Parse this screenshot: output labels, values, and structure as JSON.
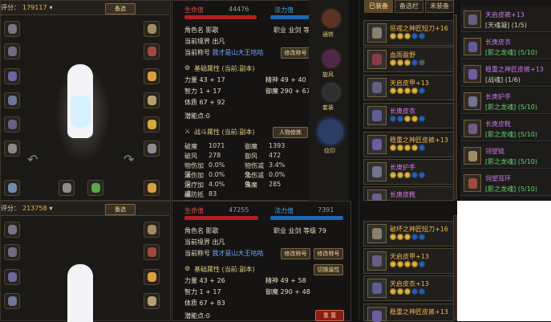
{
  "top_rating": {
    "label": "评分：",
    "value": "179117",
    "btn": "备选"
  },
  "bottom_rating": {
    "label": "评分：",
    "value": "213758",
    "btn": "备选"
  },
  "top_panel": {
    "hp_label": "生命值",
    "hp_value": "44476",
    "mp_label": "法力值",
    "role_label": "角色名",
    "role_value": "影歌",
    "job_label": "职业",
    "job_value": "业剑",
    "level_label": "等级",
    "level_value": "",
    "realm_label": "当前境界",
    "realm_value": "出凡",
    "title_label": "当前称号",
    "title_value": "我才是山大王咕咕",
    "modify_btn": "修改称号",
    "basic_title": "基础属性 (当前:副本)",
    "power": "力量 43 + 17",
    "spirit": "精神 49 + 40",
    "int": "智力 1 + 17",
    "def": "御魔 290 + 67",
    "con": "体质 67 + 92",
    "potential": "潜能点:0",
    "combat_title": "战斗属性 (当前:副本)",
    "combat_btn": "人物修炼",
    "combat_rows": [
      [
        "破魔",
        "1071",
        "御魔",
        "1393"
      ],
      [
        "破风",
        "278",
        "御风",
        "472"
      ],
      [
        "物伤加深",
        "0.0%",
        "物伤减免",
        "3.4%"
      ],
      [
        "法伤加深",
        "0.0%",
        "法伤减免",
        "0.0%"
      ],
      [
        "治疗加成",
        "4.0%",
        "诛魔",
        "285"
      ],
      [
        "破防抵抗",
        "83",
        "",
        ""
      ]
    ]
  },
  "bottom_panel": {
    "hp_label": "生命值",
    "hp_value": "47255",
    "mp_label": "法力值",
    "mp_value": "7391",
    "role_label": "角色名",
    "role_value": "影歌",
    "job_label": "职业",
    "job_value": "业剑",
    "level_label": "等级",
    "level_value": "79",
    "realm_label": "当前境界",
    "realm_value": "出凡",
    "title_label": "当前称号",
    "title_value": "我才是山大王咕咕",
    "modify_btn": "修改称号",
    "modify_btn2": "修改称号",
    "basic_title": "基础属性 (当前:副本)",
    "switch_btn": "切换属性",
    "power": "力量 43 + 26",
    "spirit": "精神 49 + 58",
    "int": "智力 1 + 17",
    "def": "御魔 290 + 48",
    "con": "体质 67 + 83",
    "potential": "潜能点:0",
    "reset_btn": "重 置"
  },
  "side_buttons": [
    "通铁",
    "旋风",
    "套装",
    "纹印"
  ],
  "tabs": [
    "已装备",
    "备选栏",
    "未装备"
  ],
  "top_items": [
    {
      "name": "惩戒之神匠短刀+16",
      "color": "#8c7f6c"
    },
    {
      "name": "血雨盈野",
      "color": "#8a3a46"
    },
    {
      "name": "天启皮甲+13",
      "color": "#655e7f"
    },
    {
      "name": "长庚皮衣",
      "color": "#5f5d93"
    },
    {
      "name": "稳重之神匠皮裤+13",
      "color": "#6d5c9f"
    },
    {
      "name": "长庚护手",
      "color": "#727391"
    },
    {
      "name": "长庚皮靴",
      "color": "#6e5d87"
    }
  ],
  "bottom_items": [
    {
      "name": "破坏之神匠短刀+16",
      "color": "#8c7f6c"
    },
    {
      "name": "天启皮甲+13",
      "color": "#655e7f"
    },
    {
      "name": "天启皮衣+13",
      "color": "#5f5d93"
    },
    {
      "name": "稳重之神匠皮裤+13",
      "color": "#6d5c9f"
    }
  ],
  "right_items": [
    {
      "name": "天启皮裤+13",
      "sub": "[天魂凝] (1/5)"
    },
    {
      "name": "长庚皮衣",
      "sub": "[影之龙魂] (5/10)"
    },
    {
      "name": "稳重之神匠皮裤+13",
      "sub": "[战魂] (1/6)"
    },
    {
      "name": "长庚护手",
      "sub": "[影之龙魂] (5/10)"
    },
    {
      "name": "长庚皮靴",
      "sub": "[影之龙魂] (5/10)"
    },
    {
      "name": "翎望链",
      "sub": "[影之龙魂] (5/10)"
    },
    {
      "name": "翎望耳环",
      "sub": "[影之龙魂] (5/10)"
    }
  ]
}
